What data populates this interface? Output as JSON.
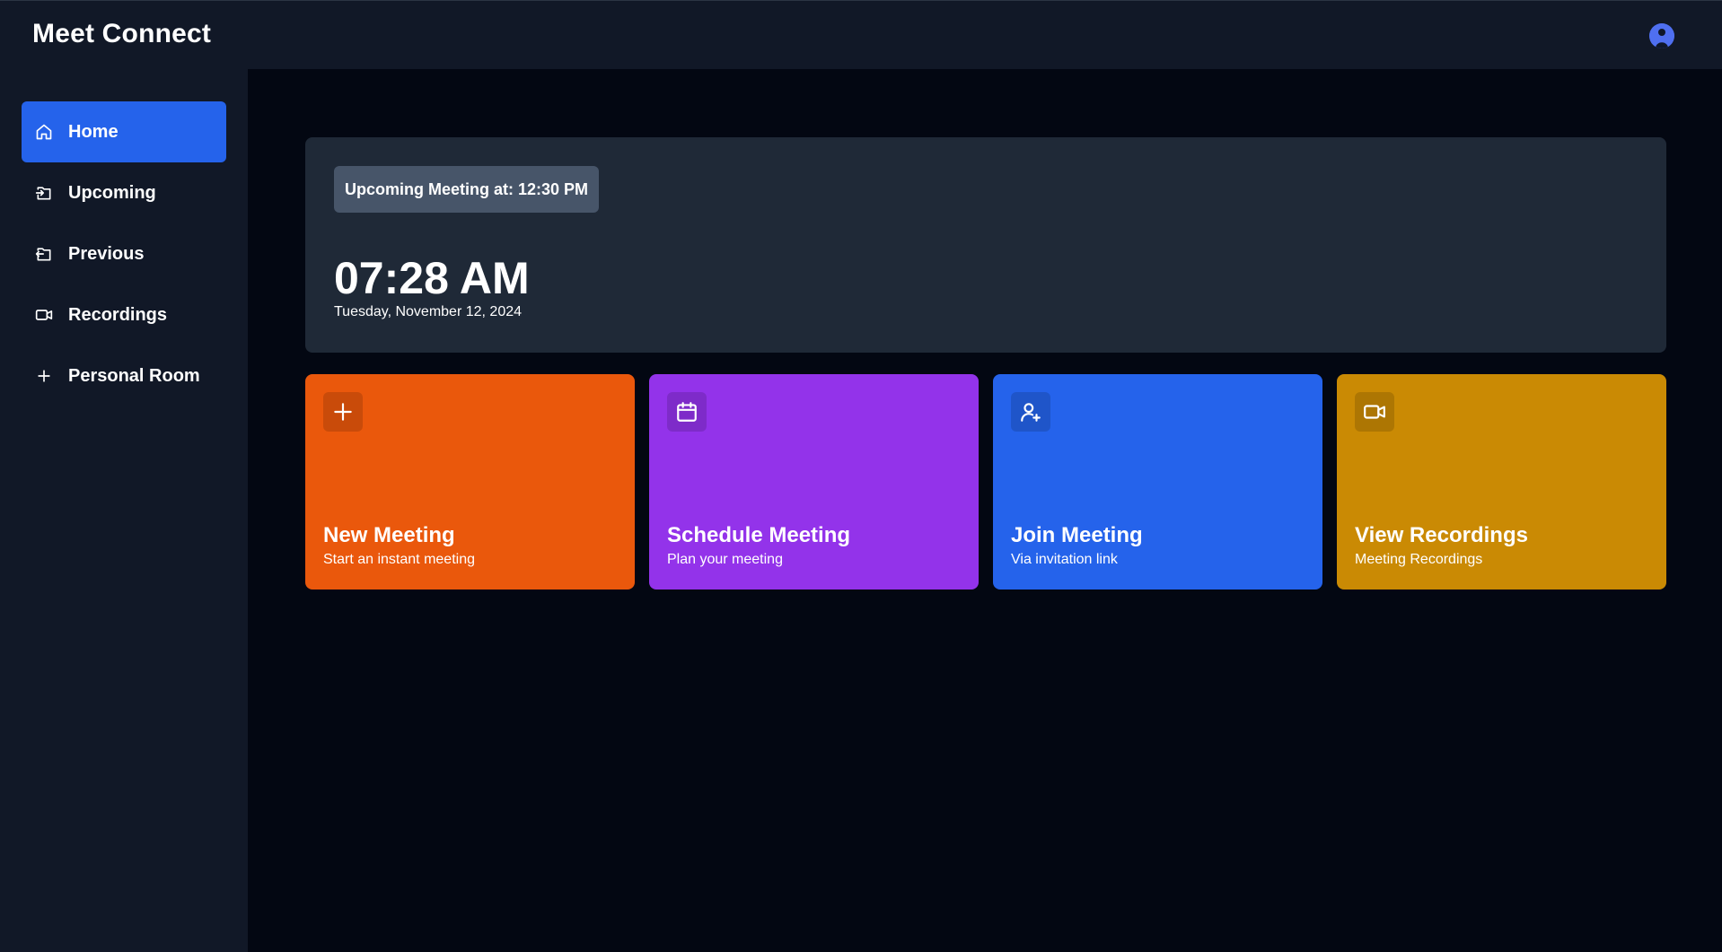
{
  "app": {
    "title": "Meet Connect"
  },
  "header": {
    "avatar_icon": "user-avatar-icon"
  },
  "sidebar": {
    "items": [
      {
        "label": "Home",
        "icon": "home-icon",
        "active": true
      },
      {
        "label": "Upcoming",
        "icon": "upcoming-icon",
        "active": false
      },
      {
        "label": "Previous",
        "icon": "previous-icon",
        "active": false
      },
      {
        "label": "Recordings",
        "icon": "video-icon",
        "active": false
      },
      {
        "label": "Personal Room",
        "icon": "plus-icon",
        "active": false
      }
    ]
  },
  "hero": {
    "badge": "Upcoming Meeting at: 12:30 PM",
    "time": "07:28 AM",
    "date": "Tuesday, November 12, 2024"
  },
  "cards": [
    {
      "title": "New Meeting",
      "subtitle": "Start an instant meeting",
      "icon": "plus-icon",
      "color": "#ea580c"
    },
    {
      "title": "Schedule Meeting",
      "subtitle": "Plan your meeting",
      "icon": "calendar-icon",
      "color": "#9333ea"
    },
    {
      "title": "Join Meeting",
      "subtitle": "Via invitation link",
      "icon": "user-plus-icon",
      "color": "#2563eb"
    },
    {
      "title": "View Recordings",
      "subtitle": "Meeting Recordings",
      "icon": "video-icon",
      "color": "#ca8a04"
    }
  ],
  "colors": {
    "background": "#030712",
    "surface": "#111827",
    "hero": "#1f2937",
    "accent": "#2563eb",
    "badge": "#475569"
  }
}
